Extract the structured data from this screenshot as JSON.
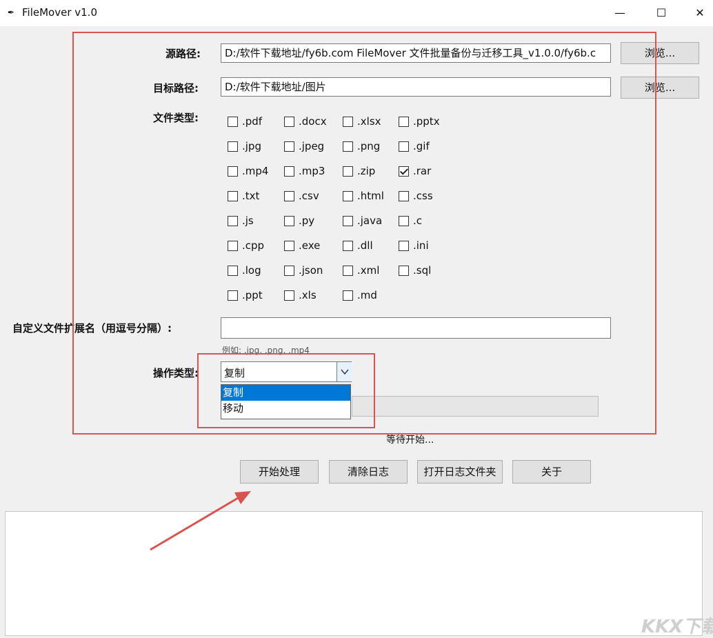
{
  "window": {
    "title": "FileMover v1.0",
    "app_icon": "feather-icon",
    "minimize_icon": "minimize-icon",
    "maximize_icon": "maximize-icon",
    "close_icon": "close-icon"
  },
  "source": {
    "label": "源路径:",
    "value": "D:/软件下载地址/fy6b.com FileMover 文件批量备份与迁移工具_v1.0.0/fy6b.c",
    "browse_label": "浏览..."
  },
  "target": {
    "label": "目标路径:",
    "value": "D:/软件下载地址/图片",
    "browse_label": "浏览..."
  },
  "file_types": {
    "label": "文件类型:",
    "rows": [
      [
        {
          "ext": ".pdf",
          "checked": false
        },
        {
          "ext": ".docx",
          "checked": false
        },
        {
          "ext": ".xlsx",
          "checked": false
        },
        {
          "ext": ".pptx",
          "checked": false
        }
      ],
      [
        {
          "ext": ".jpg",
          "checked": false
        },
        {
          "ext": ".jpeg",
          "checked": false
        },
        {
          "ext": ".png",
          "checked": false
        },
        {
          "ext": ".gif",
          "checked": false
        }
      ],
      [
        {
          "ext": ".mp4",
          "checked": false
        },
        {
          "ext": ".mp3",
          "checked": false
        },
        {
          "ext": ".zip",
          "checked": false
        },
        {
          "ext": ".rar",
          "checked": true
        }
      ],
      [
        {
          "ext": ".txt",
          "checked": false
        },
        {
          "ext": ".csv",
          "checked": false
        },
        {
          "ext": ".html",
          "checked": false
        },
        {
          "ext": ".css",
          "checked": false
        }
      ],
      [
        {
          "ext": ".js",
          "checked": false
        },
        {
          "ext": ".py",
          "checked": false
        },
        {
          "ext": ".java",
          "checked": false
        },
        {
          "ext": ".c",
          "checked": false
        }
      ],
      [
        {
          "ext": ".cpp",
          "checked": false
        },
        {
          "ext": ".exe",
          "checked": false
        },
        {
          "ext": ".dll",
          "checked": false
        },
        {
          "ext": ".ini",
          "checked": false
        }
      ],
      [
        {
          "ext": ".log",
          "checked": false
        },
        {
          "ext": ".json",
          "checked": false
        },
        {
          "ext": ".xml",
          "checked": false
        },
        {
          "ext": ".sql",
          "checked": false
        }
      ],
      [
        {
          "ext": ".ppt",
          "checked": false
        },
        {
          "ext": ".xls",
          "checked": false
        },
        {
          "ext": ".md",
          "checked": false
        }
      ]
    ]
  },
  "custom_ext": {
    "label": "自定义文件扩展名（用逗号分隔）:",
    "value": "",
    "hint": "例如: .jpg, .png, .mp4"
  },
  "operation": {
    "label": "操作类型:",
    "selected": "复制",
    "arrow_icon": "chevron-down-icon",
    "options": [
      {
        "label": "复制",
        "highlighted": true
      },
      {
        "label": "移动",
        "highlighted": false
      }
    ]
  },
  "progress": {
    "value": 0
  },
  "status": "等待开始...",
  "buttons": {
    "start": "开始处理",
    "clear_log": "清除日志",
    "open_log_folder": "打开日志文件夹",
    "about": "关于"
  },
  "log": {
    "text": ""
  },
  "watermark": "KKX下载",
  "annotation_color": "#d9534f"
}
